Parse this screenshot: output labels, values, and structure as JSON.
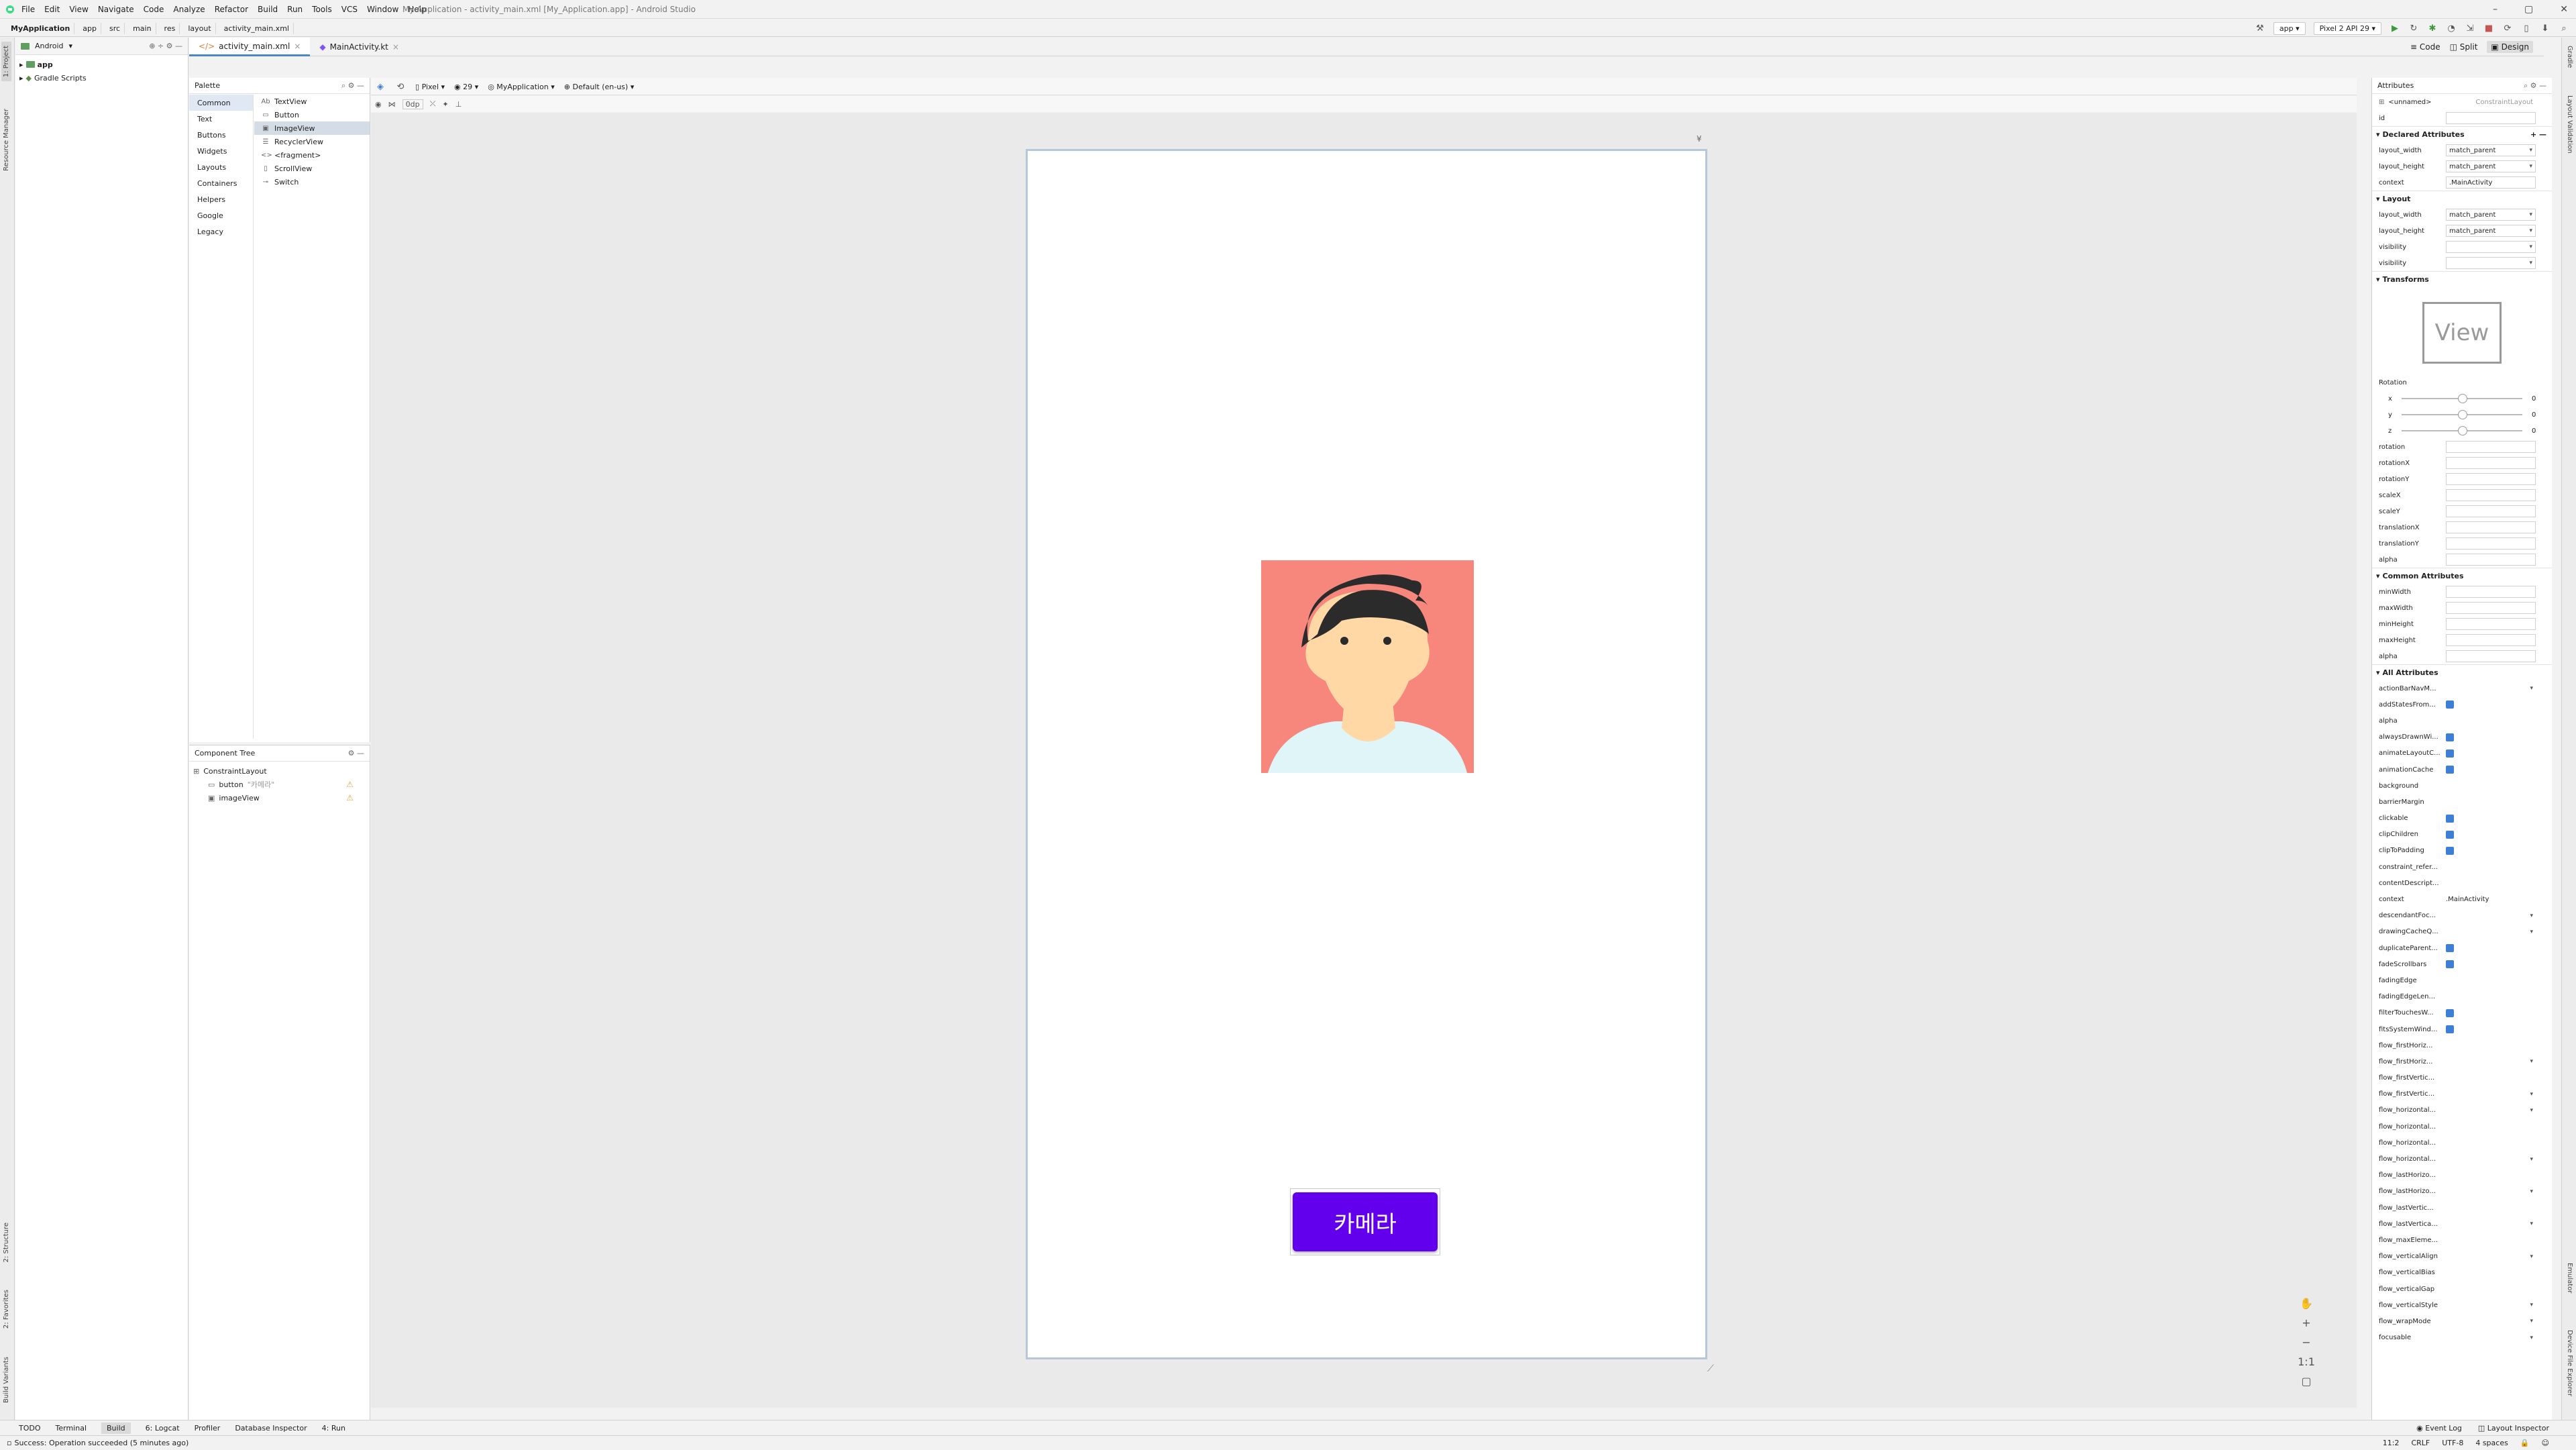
{
  "menubar": {
    "menus": [
      "File",
      "Edit",
      "View",
      "Navigate",
      "Code",
      "Analyze",
      "Refactor",
      "Build",
      "Run",
      "Tools",
      "VCS",
      "Window",
      "Help"
    ],
    "title": "My Application - activity_main.xml [My_Application.app] - Android Studio"
  },
  "navbar": {
    "crumbs": [
      "MyApplication",
      "app",
      "src",
      "main",
      "res",
      "layout",
      "activity_main.xml"
    ],
    "run_config": "app",
    "device": "Pixel 2 API 29"
  },
  "left_tabs": [
    "1: Project",
    "Resource Manager",
    "2: Structure",
    "2: Favorites",
    "Build Variants"
  ],
  "right_tabs": [
    "Gradle",
    "Layout Validation",
    "Emulator",
    "Device File Explorer"
  ],
  "project": {
    "view": "Android",
    "items": [
      "app",
      "Gradle Scripts"
    ]
  },
  "editor": {
    "tabs": [
      "activity_main.xml",
      "MainActivity.kt"
    ],
    "modes": [
      "Code",
      "Split",
      "Design"
    ]
  },
  "palette": {
    "title": "Palette",
    "categories": [
      "Common",
      "Text",
      "Buttons",
      "Widgets",
      "Layouts",
      "Containers",
      "Helpers",
      "Google",
      "Legacy"
    ],
    "widgets": [
      {
        "icon": "Ab",
        "label": "TextView"
      },
      {
        "icon": "▭",
        "label": "Button"
      },
      {
        "icon": "▣",
        "label": "ImageView"
      },
      {
        "icon": "☰",
        "label": "RecyclerView"
      },
      {
        "icon": "<>",
        "label": "<fragment>"
      },
      {
        "icon": "▯",
        "label": "ScrollView"
      },
      {
        "icon": "⊸",
        "label": "Switch"
      }
    ]
  },
  "component_tree": {
    "title": "Component Tree",
    "root": "ConstraintLayout",
    "children": [
      {
        "label": "button",
        "sub": "\"카메라\""
      },
      {
        "label": "imageView",
        "sub": ""
      }
    ]
  },
  "design_toolbar": {
    "device": "Pixel",
    "api": "29",
    "theme": "MyApplication",
    "locale": "Default (en-us)",
    "margin": "0dp"
  },
  "preview": {
    "button_label": "카메라"
  },
  "attributes": {
    "title": "Attributes",
    "id_name": "<unnamed>",
    "id_class": "ConstraintLayout",
    "id_label": "id",
    "declared_title": "Declared Attributes",
    "declared": [
      {
        "label": "layout_width",
        "value": "match_parent"
      },
      {
        "label": "layout_height",
        "value": "match_parent"
      },
      {
        "label": "context",
        "value": ".MainActivity"
      }
    ],
    "layout_title": "Layout",
    "layout": [
      {
        "label": "layout_width",
        "value": "match_parent"
      },
      {
        "label": "layout_height",
        "value": "match_parent"
      },
      {
        "label": "visibility",
        "value": ""
      },
      {
        "label": "visibility",
        "value": ""
      }
    ],
    "transforms_title": "Transforms",
    "view_preview": "View",
    "rotation_label": "Rotation",
    "rotation_axes": [
      {
        "axis": "x",
        "value": "0"
      },
      {
        "axis": "y",
        "value": "0"
      },
      {
        "axis": "z",
        "value": "0"
      }
    ],
    "transform_fields": [
      "rotation",
      "rotationX",
      "rotationY",
      "scaleX",
      "scaleY",
      "translationX",
      "translationY",
      "alpha"
    ],
    "common_title": "Common Attributes",
    "common_fields": [
      "minWidth",
      "maxWidth",
      "minHeight",
      "maxHeight",
      "alpha"
    ],
    "all_title": "All Attributes",
    "all": [
      {
        "label": "actionBarNavM...",
        "kind": "dd"
      },
      {
        "label": "addStatesFrom...",
        "kind": "cb"
      },
      {
        "label": "alpha",
        "kind": ""
      },
      {
        "label": "alwaysDrawnWi...",
        "kind": "cb"
      },
      {
        "label": "animateLayoutC...",
        "kind": "cb"
      },
      {
        "label": "animationCache",
        "kind": "cb"
      },
      {
        "label": "background",
        "kind": ""
      },
      {
        "label": "barrierMargin",
        "kind": ""
      },
      {
        "label": "clickable",
        "kind": "cb"
      },
      {
        "label": "clipChildren",
        "kind": "cb"
      },
      {
        "label": "clipToPadding",
        "kind": "cb"
      },
      {
        "label": "constraint_refer...",
        "kind": ""
      },
      {
        "label": "contentDescript...",
        "kind": ""
      },
      {
        "label": "context",
        "kind": "text",
        "value": ".MainActivity"
      },
      {
        "label": "descendantFoc...",
        "kind": "dd"
      },
      {
        "label": "drawingCacheQ...",
        "kind": "dd"
      },
      {
        "label": "duplicateParent...",
        "kind": "cb"
      },
      {
        "label": "fadeScrollbars",
        "kind": "cb"
      },
      {
        "label": "fadingEdge",
        "kind": ""
      },
      {
        "label": "fadingEdgeLen...",
        "kind": ""
      },
      {
        "label": "filterTouchesW...",
        "kind": "cb"
      },
      {
        "label": "fitsSystemWind...",
        "kind": "cb"
      },
      {
        "label": "flow_firstHoriz...",
        "kind": ""
      },
      {
        "label": "flow_firstHoriz...",
        "kind": "dd"
      },
      {
        "label": "flow_firstVertic...",
        "kind": ""
      },
      {
        "label": "flow_firstVertic...",
        "kind": "dd"
      },
      {
        "label": "flow_horizontal...",
        "kind": "dd"
      },
      {
        "label": "flow_horizontal...",
        "kind": ""
      },
      {
        "label": "flow_horizontal...",
        "kind": ""
      },
      {
        "label": "flow_horizontal...",
        "kind": "dd"
      },
      {
        "label": "flow_lastHorizo...",
        "kind": ""
      },
      {
        "label": "flow_lastHorizo...",
        "kind": "dd"
      },
      {
        "label": "flow_lastVertic...",
        "kind": ""
      },
      {
        "label": "flow_lastVertica...",
        "kind": "dd"
      },
      {
        "label": "flow_maxEleme...",
        "kind": ""
      },
      {
        "label": "flow_verticalAlign",
        "kind": "dd"
      },
      {
        "label": "flow_verticalBias",
        "kind": ""
      },
      {
        "label": "flow_verticalGap",
        "kind": ""
      },
      {
        "label": "flow_verticalStyle",
        "kind": "dd"
      },
      {
        "label": "flow_wrapMode",
        "kind": "dd"
      },
      {
        "label": "focusable",
        "kind": "dd"
      }
    ]
  },
  "bottom_tabs": [
    "TODO",
    "Terminal",
    "Build",
    "6: Logcat",
    "Profiler",
    "Database Inspector",
    "4: Run"
  ],
  "bottom_right": [
    "Event Log",
    "Layout Inspector"
  ],
  "status": {
    "message": "Success: Operation succeeded (5 minutes ago)",
    "position": "11:2",
    "line_sep": "CRLF",
    "encoding": "UTF-8",
    "indent": "4 spaces"
  }
}
